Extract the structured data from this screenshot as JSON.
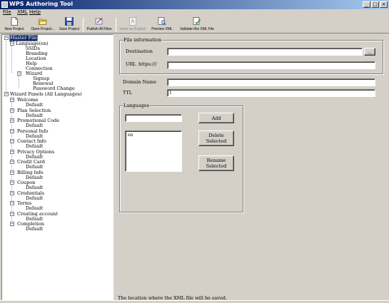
{
  "window": {
    "title": "WPS Authoring Tool"
  },
  "window_controls": {
    "minimize": "_",
    "maximize": "□",
    "close": "×"
  },
  "menu": {
    "file": "File",
    "xml": "XML",
    "help": "Help"
  },
  "toolbar": {
    "new_project": "New Project",
    "open_project": "Open Project...",
    "save_project": "Save Project",
    "publish_all": "Publish All Files",
    "same_as_english": "Same as English",
    "preview_xml": "Preview XML",
    "validate_xml": "Validate this XML File"
  },
  "tree": {
    "master_file": "Master File",
    "language_en": "Language(en)",
    "ssids": "SSIDs",
    "branding": "Branding",
    "location": "Location",
    "help": "Help",
    "connection": "Connection",
    "wizard": "Wizard",
    "signup": "Signup",
    "renewal": "Renewal",
    "password_change": "Password Change",
    "wizard_panels": "Wizard Panels (All Languages)",
    "panels": [
      {
        "name": "Welcome",
        "child": "Default"
      },
      {
        "name": "Plan Selection",
        "child": "Default"
      },
      {
        "name": "Promotional Code",
        "child": "Default"
      },
      {
        "name": "Personal Info",
        "child": "Default"
      },
      {
        "name": "Contact Info",
        "child": "Default"
      },
      {
        "name": "Privacy Options",
        "child": "Default"
      },
      {
        "name": "Credit Card",
        "child": "Default"
      },
      {
        "name": "Billing Info",
        "child": "Default"
      },
      {
        "name": "Coupon",
        "child": "Default"
      },
      {
        "name": "Credentials",
        "child": "Default"
      },
      {
        "name": "Terms",
        "child": "Default"
      },
      {
        "name": "Creating account",
        "child": "Default"
      },
      {
        "name": "Completion",
        "child": "Default"
      }
    ]
  },
  "file_info": {
    "legend": "File information",
    "destination_label": "Destination",
    "destination_value": "",
    "browse_label": "...",
    "url_label": "URL",
    "url_prefix": "https:///",
    "url_value": ""
  },
  "domain": {
    "label": "Domain Name",
    "value": ""
  },
  "ttl": {
    "label": "TTL",
    "value": "1"
  },
  "languages": {
    "legend": "Languages",
    "new_value": "",
    "add_label": "Add",
    "items": [
      "en"
    ],
    "delete_label": "Delete Selected",
    "rename_label": "Rename Selected"
  },
  "status": {
    "text": "The location where the XML file will be saved."
  }
}
